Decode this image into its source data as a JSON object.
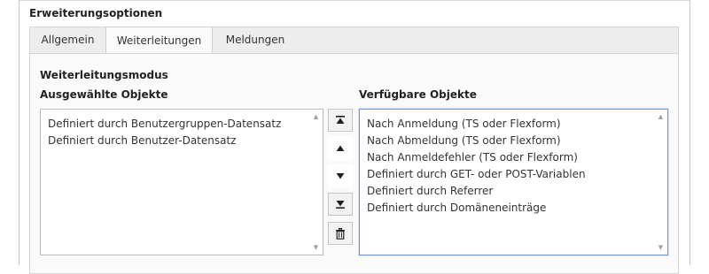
{
  "section": {
    "title": "Erweiterungsoptionen"
  },
  "tabs": [
    {
      "label": "Allgemein",
      "active": false
    },
    {
      "label": "Weiterleitungen",
      "active": true
    },
    {
      "label": "Meldungen",
      "active": false
    }
  ],
  "panel": {
    "title": "Weiterleitungsmodus",
    "selected_label": "Ausgewählte Objekte",
    "available_label": "Verfügbare Objekte",
    "selected_items": [
      "Definiert durch Benutzergruppen-Datensatz",
      "Definiert durch Benutzer-Datensatz"
    ],
    "available_items": [
      "Nach Anmeldung (TS oder Flexform)",
      "Nach Abmeldung (TS oder Flexform)",
      "Nach Anmeldefehler (TS oder Flexform)",
      "Definiert durch GET- oder POST-Variablen",
      "Definiert durch Referrer",
      "Definiert durch Domäneneinträge"
    ]
  },
  "buttons": {
    "icons": [
      "move-to-top-icon",
      "move-up-icon",
      "move-down-icon",
      "move-to-bottom-icon",
      "trash-icon"
    ]
  },
  "colors": {
    "focus_border": "#6a9bd8",
    "tab_background": "#ededed",
    "panel_background": "#fafafa"
  }
}
